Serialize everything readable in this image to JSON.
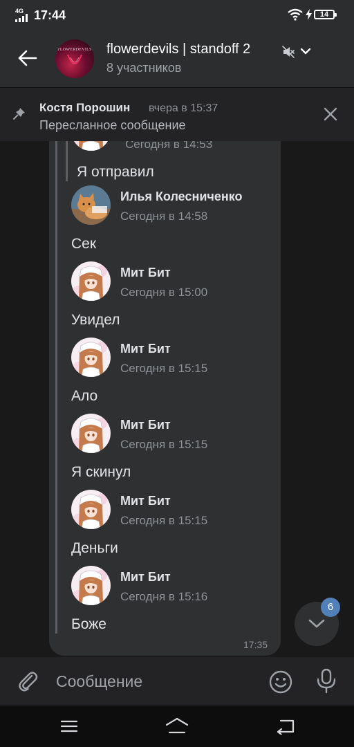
{
  "status_bar": {
    "network": "4G",
    "time": "17:44",
    "battery": "14"
  },
  "header": {
    "title": "flowerdevils | standoff 2",
    "subtitle": "8 участников",
    "avatar_text": "FLOWERDEVILS",
    "icons": [
      "back-arrow-icon",
      "mute-icon",
      "chevron-down-icon"
    ]
  },
  "pinned": {
    "author": "Костя Порошин",
    "date": "вчера в 15:37",
    "text": "Пересланное сообщение"
  },
  "chat": {
    "partial_top": {
      "time": "Сегодня в 14:53",
      "text": "Я отправил"
    },
    "messages": [
      {
        "sender": "Илья Колесниченко",
        "time": "Сегодня в 14:58",
        "text": "Сек",
        "avatar": "cat-photo"
      },
      {
        "sender": "Мит Бит",
        "time": "Сегодня в 15:00",
        "text": "Увидел",
        "avatar": "anime-girl"
      },
      {
        "sender": "Мит Бит",
        "time": "Сегодня в 15:15",
        "text": "Ало",
        "avatar": "anime-girl"
      },
      {
        "sender": "Мит Бит",
        "time": "Сегодня в 15:15",
        "text": "Я скинул",
        "avatar": "anime-girl"
      },
      {
        "sender": "Мит Бит",
        "time": "Сегодня в 15:15",
        "text": "Деньги",
        "avatar": "anime-girl"
      },
      {
        "sender": "Мит Бит",
        "time": "Сегодня в 15:16",
        "text": "Боже",
        "avatar": "anime-girl"
      }
    ],
    "bubble_time": "17:35",
    "unread_badge": "6"
  },
  "composer": {
    "placeholder": "Сообщение"
  },
  "colors": {
    "background": "#19191a",
    "bar": "#2c2d2f",
    "bubble": "#2f3032",
    "accent": "#5181b8",
    "text": "#e1e3e6",
    "secondary_text": "#8d9196"
  }
}
